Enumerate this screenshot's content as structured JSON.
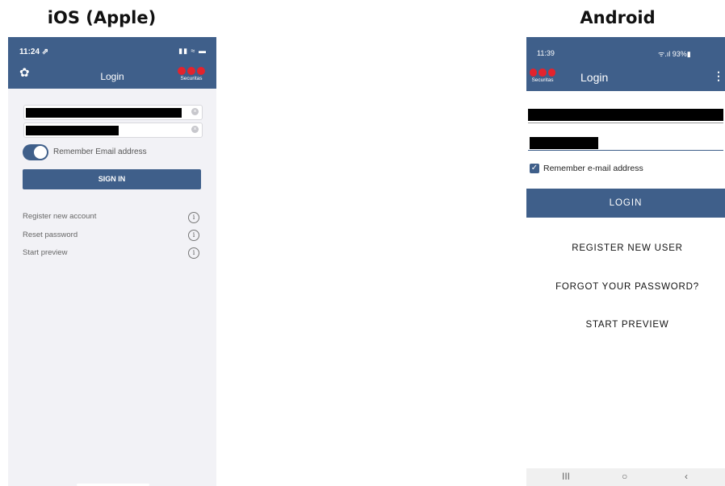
{
  "headings": {
    "ios": "iOS (Apple)",
    "android": "Android"
  },
  "ios": {
    "status_time": "11:24 ⇗",
    "status_icons": "▮▮ ≈ ▬",
    "title": "Login",
    "logo_text": "Securitas",
    "remember_label": "Remember Email address",
    "remember_on": true,
    "signin_label": "SIGN IN",
    "links": [
      {
        "label": "Register new account"
      },
      {
        "label": "Reset password"
      },
      {
        "label": "Start preview"
      }
    ],
    "info_glyph": "i"
  },
  "android": {
    "status_time": "11:39",
    "status_right": "ᯤ.ıl 93%▮",
    "title": "Login",
    "logo_text": "Securitas",
    "remember_label": "Remember e-mail address",
    "remember_checked": true,
    "login_label": "LOGIN",
    "links": [
      {
        "label": "REGISTER NEW USER"
      },
      {
        "label": "FORGOT YOUR PASSWORD?"
      },
      {
        "label": "START PREVIEW"
      }
    ],
    "nav": {
      "recents": "III",
      "home": "○",
      "back": "‹"
    }
  },
  "colors": {
    "brand_blue": "#3f5f8a",
    "logo_red": "#e3232d"
  }
}
